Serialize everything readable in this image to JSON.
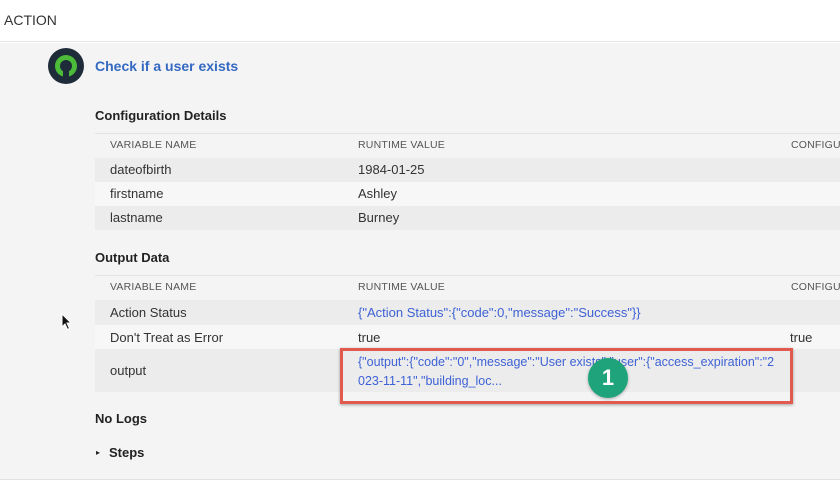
{
  "header": {
    "title": "ACTION"
  },
  "action": {
    "title": "Check if a user exists",
    "icon": "logo-ring-icon"
  },
  "config": {
    "title": "Configuration Details",
    "columns": [
      "VARIABLE NAME",
      "RUNTIME VALUE",
      "CONFIGU"
    ],
    "rows": [
      {
        "name": "dateofbirth",
        "value": "1984-01-25"
      },
      {
        "name": "firstname",
        "value": "Ashley"
      },
      {
        "name": "lastname",
        "value": "Burney"
      }
    ]
  },
  "output": {
    "title": "Output Data",
    "columns": [
      "VARIABLE NAME",
      "RUNTIME VALUE",
      "CONFIGU"
    ],
    "rows": [
      {
        "name": "Action Status",
        "value": "{\"Action Status\":{\"code\":0,\"message\":\"Success\"}}",
        "config": ""
      },
      {
        "name": "Don't Treat as Error",
        "value": "true",
        "config": "true"
      },
      {
        "name": "output",
        "value": "{\"output\":{\"code\":\"0\",\"message\":\"User exists\",\"user\":{\"access_expiration\":\"2023-11-11\",\"building_loc...",
        "config": ""
      }
    ]
  },
  "logs": {
    "label": "No Logs"
  },
  "steps": {
    "label": "Steps",
    "toggle_icon": "▸"
  },
  "annotation": {
    "number": "1",
    "color": "#1fa37a",
    "box_color": "#e05a50"
  },
  "colors": {
    "link": "#3e62d6",
    "title": "#3469c2",
    "icon_green": "#4cbb3a",
    "icon_dark": "#1e2c3a"
  }
}
